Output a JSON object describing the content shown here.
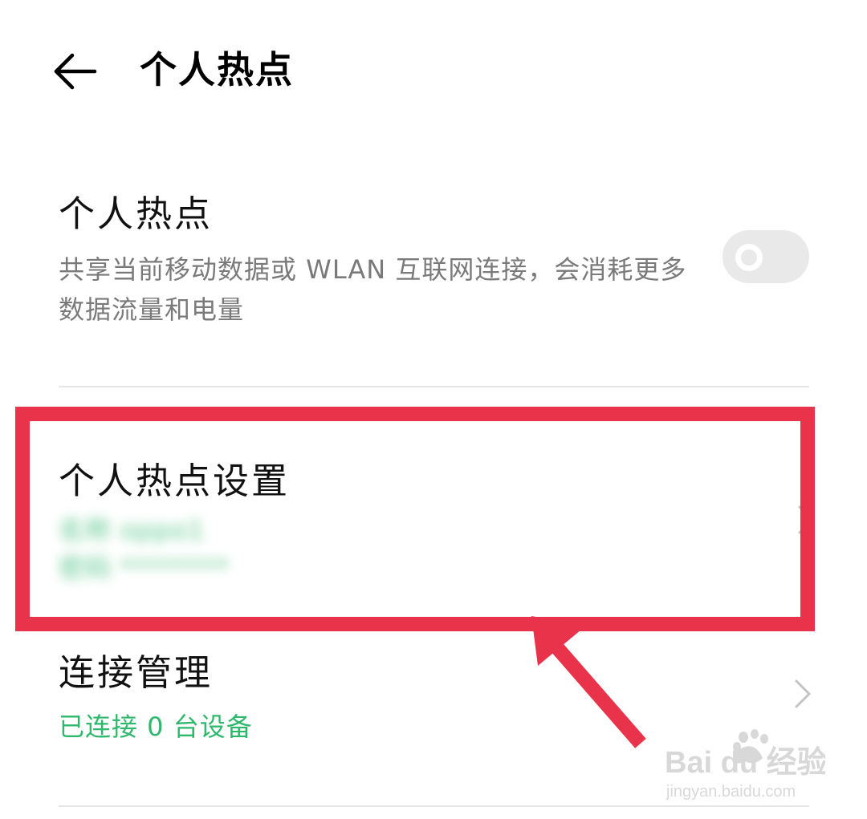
{
  "header": {
    "title": "个人热点",
    "back_icon": "back-arrow-icon"
  },
  "hotspot": {
    "title": "个人热点",
    "description": "共享当前移动数据或 WLAN 互联网连接，会消耗更多数据流量和电量",
    "toggle_state": "off"
  },
  "settings": {
    "title": "个人热点设置",
    "name_line": "名称 oppo1",
    "password_line": "密码 ********"
  },
  "connection": {
    "title": "连接管理",
    "status": "已连接 0 台设备"
  },
  "watermark": {
    "brand": "Bai du 经验",
    "url": "jingyan.baidu.com"
  },
  "colors": {
    "accent_green": "#2db86c",
    "highlight_red": "#e8334a",
    "divider": "#e6e6e6",
    "secondary_text": "#7a7a7a"
  }
}
